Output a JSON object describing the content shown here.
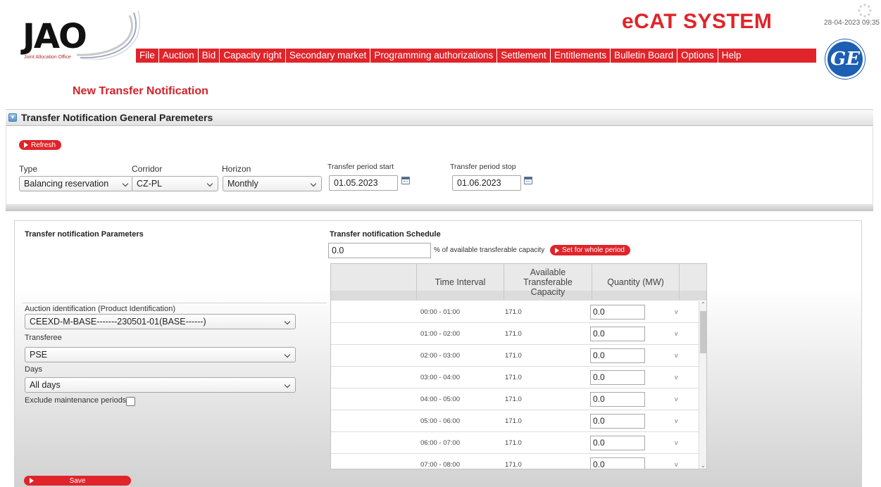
{
  "header": {
    "logo_text": "JAO",
    "logo_subtitle": "Joint Allocation Office",
    "brand": "eCAT SYSTEM",
    "datetime": "28-04-2023 09:35",
    "ge_logo": "GE"
  },
  "menu": [
    "File",
    "Auction",
    "Bid",
    "Capacity right",
    "Secondary market",
    "Programming authorizations",
    "Settlement",
    "Entitlements",
    "Bulletin Board",
    "Options",
    "Help"
  ],
  "page_title": "New Transfer Notification",
  "general": {
    "section_title": "Transfer Notification General Paremeters",
    "refresh_label": "Refresh",
    "type_label": "Type",
    "type_value": "Balancing reservation",
    "corridor_label": "Corridor",
    "corridor_value": "CZ-PL",
    "horizon_label": "Horizon",
    "horizon_value": "Monthly",
    "start_label": "Transfer period start",
    "start_value": "01.05.2023",
    "stop_label": "Transfer period stop",
    "stop_value": "01.06.2023"
  },
  "params": {
    "title": "Transfer notification Parameters",
    "auction_label": "Auction identification (Product Identification)",
    "auction_value": "CEEXD-M-BASE-------230501-01(BASE------)",
    "transferee_label": "Transferee",
    "transferee_value": "PSE",
    "days_label": "Days",
    "days_value": "All days",
    "exclude_label": "Exclude maintenance periods"
  },
  "schedule": {
    "title": "Transfer notification Schedule",
    "pct_value": "0.0",
    "pct_label": "% of available transferable capacity",
    "set_label": "Set for whole period",
    "col_time": "Time Interval",
    "col_capacity": "Available Transferable Capacity",
    "col_quantity": "Quantity (MW)",
    "rows": [
      {
        "time": "00:00 - 01:00",
        "capacity": "171.0",
        "quantity": "0.0",
        "v": "v"
      },
      {
        "time": "01:00 - 02:00",
        "capacity": "171.0",
        "quantity": "0.0",
        "v": "v"
      },
      {
        "time": "02:00 - 03:00",
        "capacity": "171.0",
        "quantity": "0.0",
        "v": "v"
      },
      {
        "time": "03:00 - 04:00",
        "capacity": "171.0",
        "quantity": "0.0",
        "v": "v"
      },
      {
        "time": "04:00 - 05:00",
        "capacity": "171.0",
        "quantity": "0.0",
        "v": "v"
      },
      {
        "time": "05:00 - 06:00",
        "capacity": "171.0",
        "quantity": "0.0",
        "v": "v"
      },
      {
        "time": "06:00 - 07:00",
        "capacity": "171.0",
        "quantity": "0.0",
        "v": "v"
      },
      {
        "time": "07:00 - 08:00",
        "capacity": "171.0",
        "quantity": "0.0",
        "v": "v"
      }
    ]
  },
  "save_label": "Save",
  "colors": {
    "accent_red": "#e0242a",
    "title_red": "#d3222a",
    "ge_blue": "#1c5fb3"
  }
}
